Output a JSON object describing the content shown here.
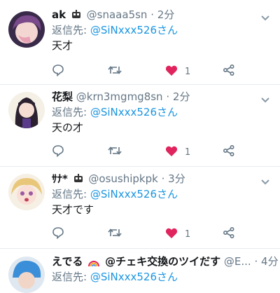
{
  "tweets": [
    {
      "name": "ak",
      "handle": "@snaaa5sn",
      "time": "2分",
      "reply_label": "返信先:",
      "reply_handle": "@SiNxxx526さん",
      "body": "天才",
      "likes": "1",
      "avatar_icon": "avatar-anime-pink-hair"
    },
    {
      "name": "花梨",
      "handle": "@krn3mgmg8sn",
      "time": "2分",
      "reply_label": "返信先:",
      "reply_handle": "@SiNxxx526さん",
      "body": "天の才",
      "likes": "1",
      "avatar_icon": "avatar-anime-dark-hair"
    },
    {
      "name": "ｻﾅ*",
      "handle": "@osushipkpk",
      "time": "3分",
      "reply_label": "返信先:",
      "reply_handle": "@SiNxxx526さん",
      "body": "天才です",
      "likes": "1",
      "avatar_icon": "avatar-anime-blonde"
    },
    {
      "name": "えでる",
      "name_suffix": "@チェキ交換のツイだす",
      "handle": "@E...",
      "time": "4分",
      "reply_label": "返信先:",
      "reply_handle": "@SiNxxx526さん",
      "avatar_icon": "avatar-blue-hat"
    }
  ],
  "colors": {
    "link": "#1b95e0",
    "muted": "#657786",
    "like": "#e0245e",
    "divider": "#e6ecf0"
  }
}
